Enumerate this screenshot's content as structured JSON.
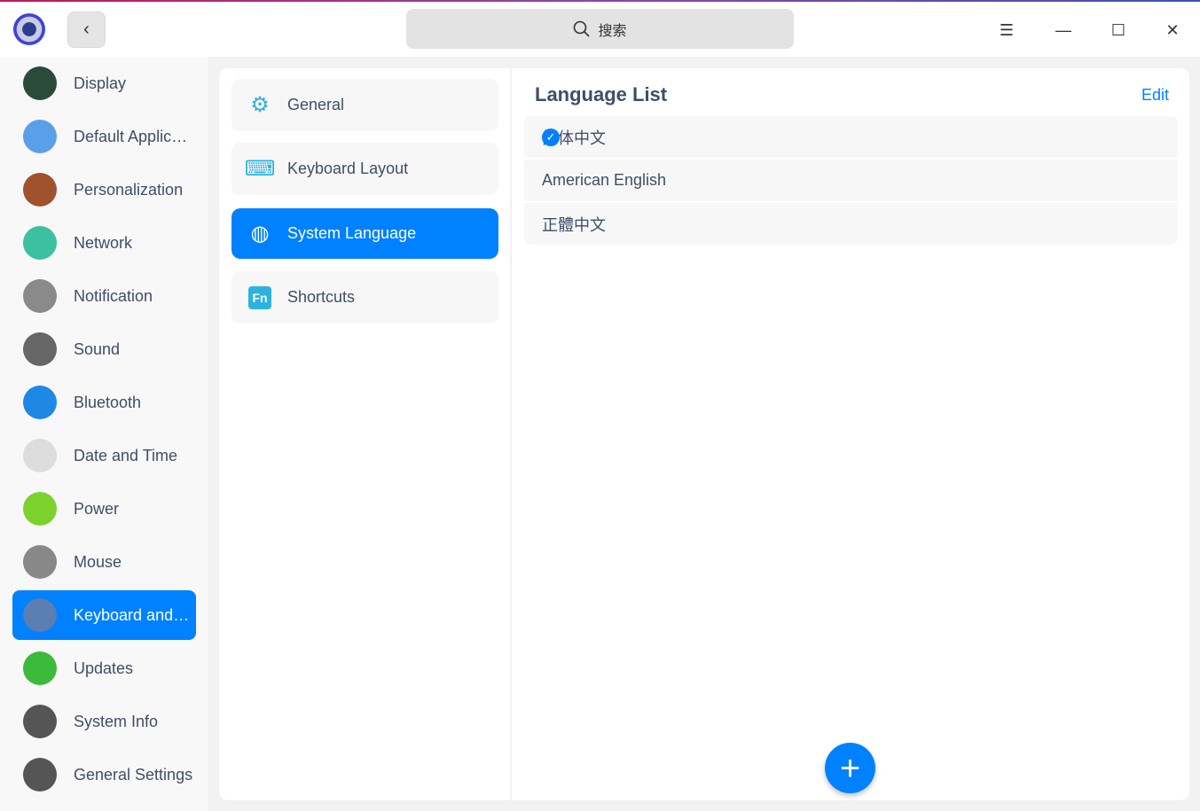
{
  "header": {
    "search_placeholder": "搜索",
    "back": "‹",
    "menu": "☰",
    "minimize": "—",
    "maximize": "☐",
    "close": "✕"
  },
  "sidebar": {
    "items": [
      {
        "label": "Display",
        "icon": "display-icon",
        "color": "#2b4a3a"
      },
      {
        "label": "Default Applic…",
        "icon": "default-apps-icon",
        "color": "#5aa0e8"
      },
      {
        "label": "Personalization",
        "icon": "palette-icon",
        "color": "#a0522d"
      },
      {
        "label": "Network",
        "icon": "network-icon",
        "color": "#3cc0a0"
      },
      {
        "label": "Notification",
        "icon": "bell-icon",
        "color": "#8a8a8a"
      },
      {
        "label": "Sound",
        "icon": "speaker-icon",
        "color": "#666"
      },
      {
        "label": "Bluetooth",
        "icon": "bluetooth-icon",
        "color": "#1e88e5"
      },
      {
        "label": "Date and Time",
        "icon": "clock-icon",
        "color": "#ddd"
      },
      {
        "label": "Power",
        "icon": "battery-icon",
        "color": "#7bd22c"
      },
      {
        "label": "Mouse",
        "icon": "mouse-icon",
        "color": "#888"
      },
      {
        "label": "Keyboard and…",
        "icon": "keyboard-icon",
        "color": "#5a7fb0",
        "selected": true
      },
      {
        "label": "Updates",
        "icon": "update-icon",
        "color": "#3cba3c"
      },
      {
        "label": "System Info",
        "icon": "system-info-icon",
        "color": "#555"
      },
      {
        "label": "General Settings",
        "icon": "gear-icon",
        "color": "#555"
      }
    ]
  },
  "middle": {
    "items": [
      {
        "label": "General",
        "icon": "⚙"
      },
      {
        "label": "Keyboard Layout",
        "icon": "⌨"
      },
      {
        "label": "System Language",
        "icon": "◍",
        "selected": true
      },
      {
        "label": "Shortcuts",
        "icon": "Fn"
      }
    ]
  },
  "right": {
    "title": "Language List",
    "edit": "Edit",
    "languages": [
      {
        "label": "简体中文",
        "checked": true
      },
      {
        "label": "American English"
      },
      {
        "label": "正體中文"
      }
    ],
    "add": "+"
  },
  "colors": {
    "accent": "#0081ff"
  }
}
